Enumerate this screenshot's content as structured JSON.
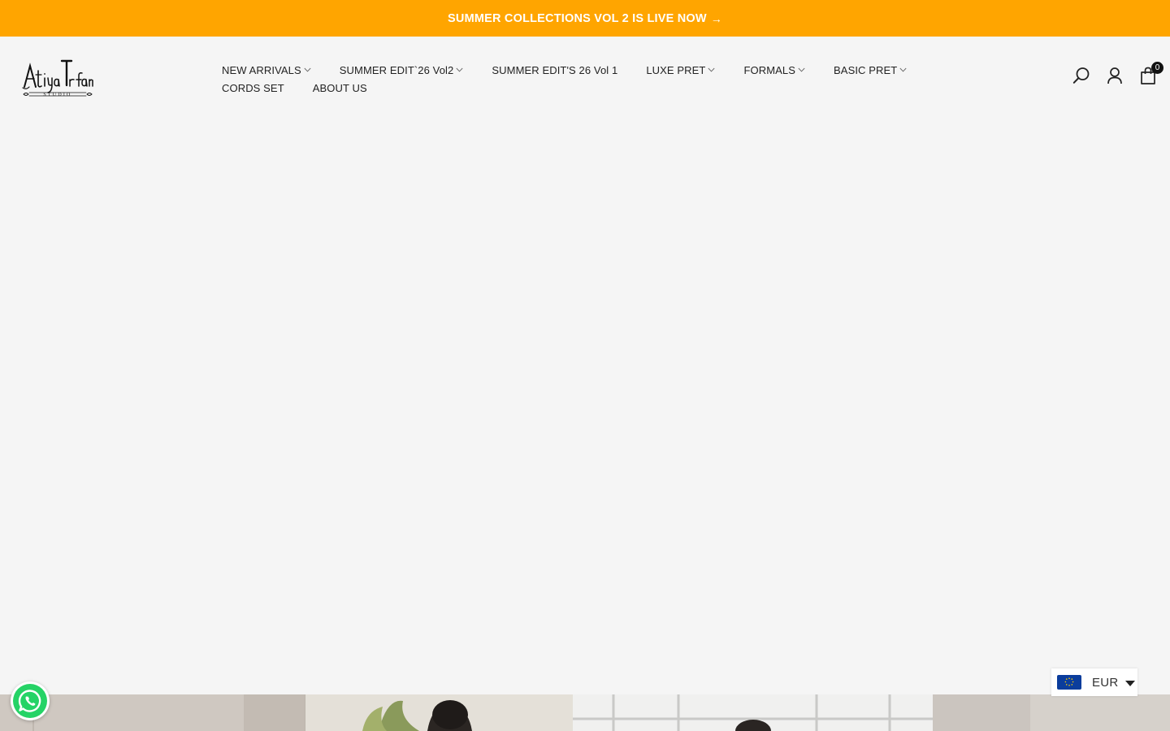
{
  "announcement": {
    "text": "SUMMER COLLECTIONS VOL 2 IS LIVE NOW",
    "arrow": "→",
    "background": "#ffa500"
  },
  "brand": {
    "logo_text": "Atiya Irfan",
    "logo_sub": "STUDIO"
  },
  "nav": {
    "row1": [
      {
        "label": "NEW ARRIVALS",
        "has_dropdown": true
      },
      {
        "label": "SUMMER EDIT`26 Vol2",
        "has_dropdown": true
      },
      {
        "label": "SUMMER EDIT'S 26 Vol 1",
        "has_dropdown": false
      },
      {
        "label": "LUXE PRET",
        "has_dropdown": true
      },
      {
        "label": "FORMALS",
        "has_dropdown": true
      },
      {
        "label": "BASIC PRET",
        "has_dropdown": true
      }
    ],
    "row2": [
      {
        "label": "CORDS SET",
        "has_dropdown": false
      },
      {
        "label": "ABOUT US",
        "has_dropdown": false
      }
    ]
  },
  "header_icons": {
    "search": "search-icon",
    "account": "account-icon",
    "cart": "cart-icon",
    "cart_count": "0"
  },
  "currency": {
    "code": "EUR",
    "flag": "eu-flag-icon"
  },
  "whatsapp": {
    "icon": "whatsapp-icon",
    "color": "#25d366"
  }
}
